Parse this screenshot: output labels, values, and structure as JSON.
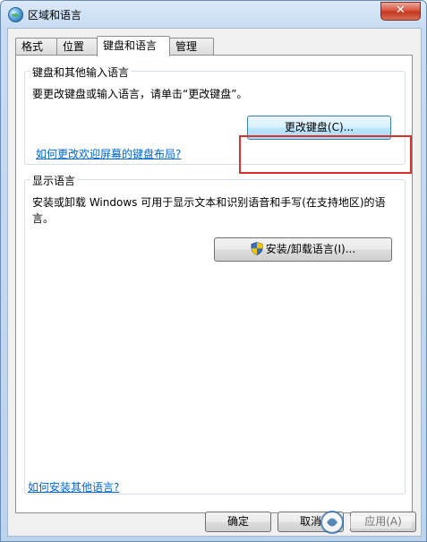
{
  "window": {
    "title": "区域和语言",
    "close_glyph": "✕"
  },
  "tabs": [
    {
      "label": "格式",
      "active": false
    },
    {
      "label": "位置",
      "active": false
    },
    {
      "label": "键盘和语言",
      "active": true
    },
    {
      "label": "管理",
      "active": false
    }
  ],
  "keyboard_group": {
    "label": "键盘和其他输入语言",
    "description": "要更改键盘或输入语言，请单击“更改键盘”。",
    "change_button": "更改键盘(C)...",
    "welcome_link": "如何更改欢迎屏幕的键盘布局?"
  },
  "display_group": {
    "label": "显示语言",
    "description_line1": "安装或卸载 Windows 可用于显示文本和识别语音和手写(在支持地区)的语",
    "description_line2": "言。",
    "install_button": "安装/卸载语言(I)..."
  },
  "footer": {
    "install_link": "如何安装其他语言?",
    "ok_button": "确定",
    "cancel_button": "取消",
    "apply_button": "应用(A)"
  },
  "colors": {
    "link": "#0066cc",
    "highlight_border": "#d9312b",
    "close_button": "#c4371f"
  }
}
